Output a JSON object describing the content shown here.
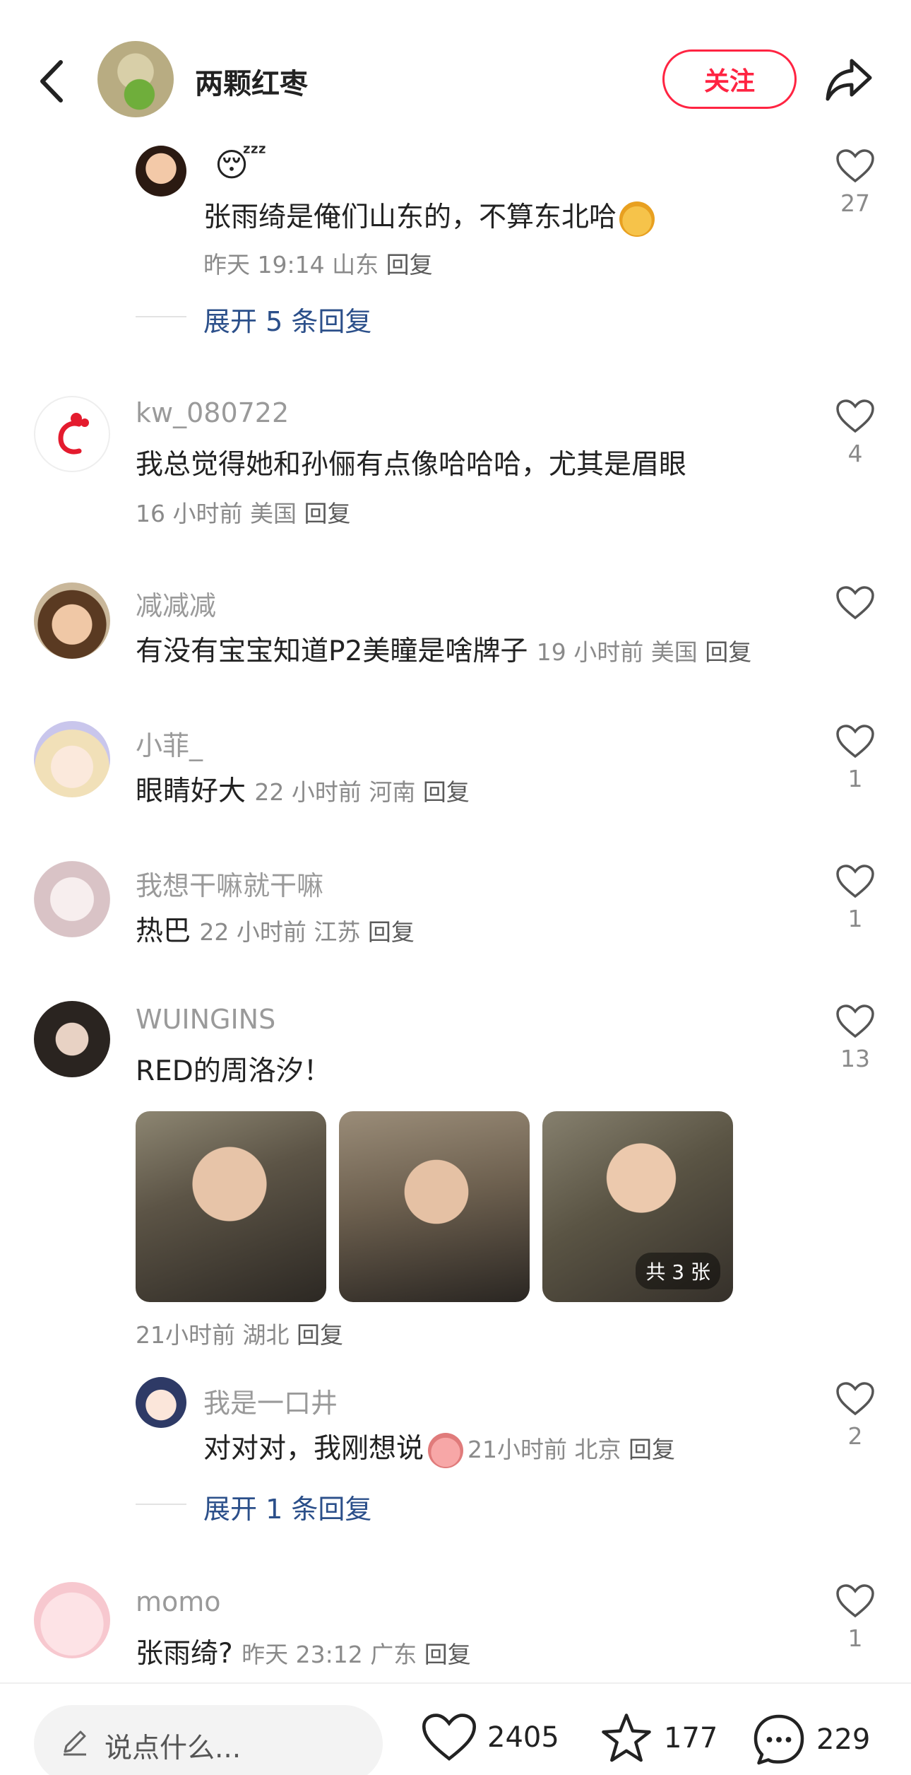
{
  "header": {
    "author_name": "两颗红枣",
    "follow_label": "关注"
  },
  "comments": [
    {
      "id": "sub-reply-1",
      "emoji": "😴",
      "text": "张雨绮是俺们山东的，不算东北哈",
      "time": "昨天 19:14",
      "location": "山东",
      "reply_label": "回复",
      "likes": "27",
      "expand_label": "展开 5 条回复"
    },
    {
      "id": "c2",
      "username": "kw_080722",
      "text": "我总觉得她和孙俪有点像哈哈哈，尤其是眉眼",
      "time": "16 小时前",
      "location": "美国",
      "reply_label": "回复",
      "likes": "4"
    },
    {
      "id": "c3",
      "username": "减减减",
      "text": "有没有宝宝知道P2美瞳是啥牌子",
      "time": "19 小时前",
      "location": "美国",
      "reply_label": "回复",
      "likes": ""
    },
    {
      "id": "c4",
      "username": "小菲_",
      "text": "眼睛好大",
      "time": "22 小时前",
      "location": "河南",
      "reply_label": "回复",
      "likes": "1"
    },
    {
      "id": "c5",
      "username": "我想干嘛就干嘛",
      "text": "热巴",
      "time": "22 小时前",
      "location": "江苏",
      "reply_label": "回复",
      "likes": "1"
    },
    {
      "id": "c6",
      "username": "WUINGINS",
      "text": "RED的周洛汐！",
      "time": "21小时前",
      "location": "湖北",
      "reply_label": "回复",
      "likes": "13",
      "image_count_label": "共 3 张"
    },
    {
      "id": "c6-reply",
      "username": "我是一口井",
      "text": "对对对，我刚想说",
      "time": "21小时前",
      "location": "北京",
      "reply_label": "回复",
      "likes": "2",
      "expand_label": "展开 1 条回复"
    },
    {
      "id": "c7",
      "username": "momo",
      "text": "张雨绮?",
      "time": "昨天 23:12",
      "location": "广东",
      "reply_label": "回复",
      "likes": "1"
    }
  ],
  "bottom_bar": {
    "input_placeholder": "说点什么...",
    "likes": "2405",
    "stars": "177",
    "comments": "229"
  },
  "colors": {
    "accent_red": "#ff2442",
    "link_blue": "#2b4f8a",
    "muted_gray": "#8a8a8a"
  },
  "icons": [
    "back-arrow-icon",
    "share-icon",
    "heart-icon",
    "star-icon",
    "comment-bubble-icon",
    "pencil-icon"
  ]
}
